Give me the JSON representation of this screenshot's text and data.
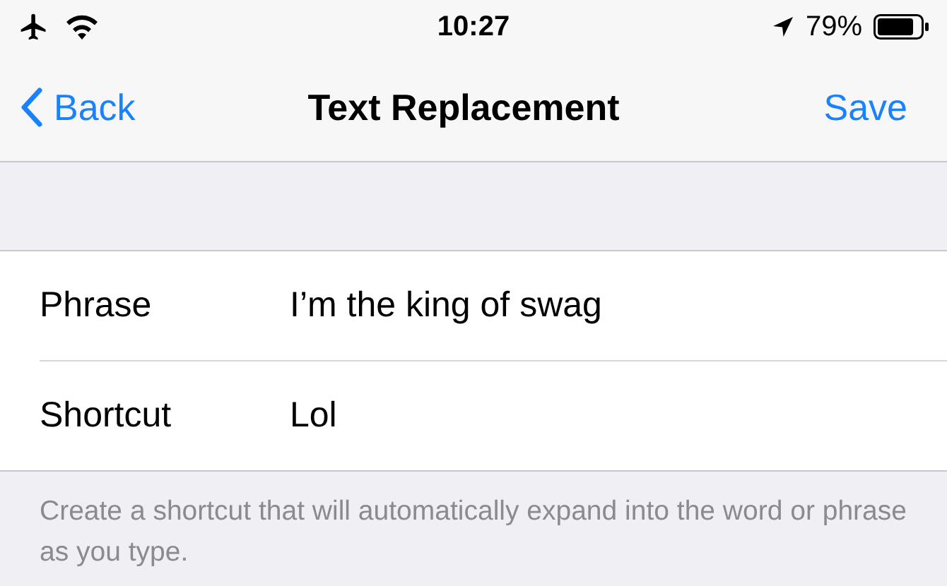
{
  "status_bar": {
    "time": "10:27",
    "battery_percent": "79%"
  },
  "nav": {
    "back": "Back",
    "title": "Text Replacement",
    "action": "Save"
  },
  "fields": [
    {
      "label": "Phrase",
      "value": "I’m the king of swag"
    },
    {
      "label": "Shortcut",
      "value": "Lol"
    }
  ],
  "footer": "Create a shortcut that will automatically expand into the word or phrase as you type."
}
